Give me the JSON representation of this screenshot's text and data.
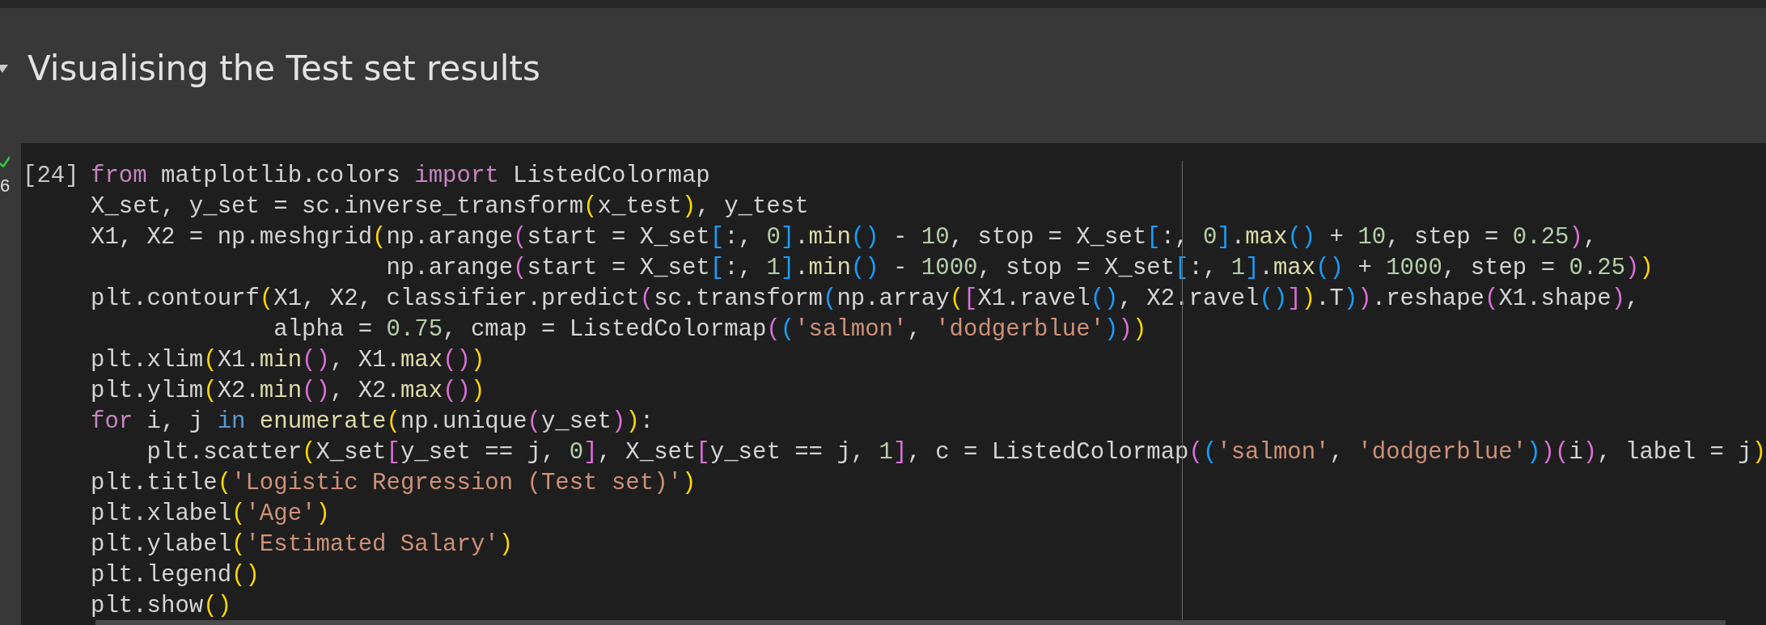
{
  "section": {
    "title": "Visualising the Test set results",
    "expanded": true
  },
  "cell": {
    "succeeded": true,
    "exec_time": "6",
    "prompt": "[24]",
    "lines": [
      {
        "tokens": [
          {
            "text": "from",
            "kind": "kw"
          },
          {
            "text": " matplotlib.colors ",
            "kind": "p"
          },
          {
            "text": "import",
            "kind": "kw"
          },
          {
            "text": " ListedColormap",
            "kind": "p"
          }
        ]
      },
      {
        "tokens": [
          {
            "text": "X_set, y_set = sc.inverse_transform",
            "kind": "p"
          },
          {
            "text": "(",
            "kind": "b1"
          },
          {
            "text": "x_test",
            "kind": "p"
          },
          {
            "text": ")",
            "kind": "b1"
          },
          {
            "text": ", y_test",
            "kind": "p"
          }
        ]
      },
      {
        "tokens": [
          {
            "text": "X1, X2 = np.meshgrid",
            "kind": "p"
          },
          {
            "text": "(",
            "kind": "b1"
          },
          {
            "text": "np.arange",
            "kind": "p"
          },
          {
            "text": "(",
            "kind": "b2"
          },
          {
            "text": "start = X_set",
            "kind": "p"
          },
          {
            "text": "[",
            "kind": "b3"
          },
          {
            "text": ":, ",
            "kind": "p"
          },
          {
            "text": "0",
            "kind": "n"
          },
          {
            "text": "]",
            "kind": "b3"
          },
          {
            "text": ".",
            "kind": "p"
          },
          {
            "text": "min",
            "kind": "f"
          },
          {
            "text": "()",
            "kind": "b3"
          },
          {
            "text": " - ",
            "kind": "p"
          },
          {
            "text": "10",
            "kind": "n"
          },
          {
            "text": ", stop = X_set",
            "kind": "p"
          },
          {
            "text": "[",
            "kind": "b3"
          },
          {
            "text": ":, ",
            "kind": "p"
          },
          {
            "text": "0",
            "kind": "n"
          },
          {
            "text": "]",
            "kind": "b3"
          },
          {
            "text": ".",
            "kind": "p"
          },
          {
            "text": "max",
            "kind": "f"
          },
          {
            "text": "()",
            "kind": "b3"
          },
          {
            "text": " + ",
            "kind": "p"
          },
          {
            "text": "10",
            "kind": "n"
          },
          {
            "text": ", step = ",
            "kind": "p"
          },
          {
            "text": "0.25",
            "kind": "n"
          },
          {
            "text": ")",
            "kind": "b2"
          },
          {
            "text": ",",
            "kind": "p"
          }
        ]
      },
      {
        "tokens": [
          {
            "text": "                     np.arange",
            "kind": "p"
          },
          {
            "text": "(",
            "kind": "b2"
          },
          {
            "text": "start = X_set",
            "kind": "p"
          },
          {
            "text": "[",
            "kind": "b3"
          },
          {
            "text": ":, ",
            "kind": "p"
          },
          {
            "text": "1",
            "kind": "n"
          },
          {
            "text": "]",
            "kind": "b3"
          },
          {
            "text": ".",
            "kind": "p"
          },
          {
            "text": "min",
            "kind": "f"
          },
          {
            "text": "()",
            "kind": "b3"
          },
          {
            "text": " - ",
            "kind": "p"
          },
          {
            "text": "1000",
            "kind": "n"
          },
          {
            "text": ", stop = X_set",
            "kind": "p"
          },
          {
            "text": "[",
            "kind": "b3"
          },
          {
            "text": ":, ",
            "kind": "p"
          },
          {
            "text": "1",
            "kind": "n"
          },
          {
            "text": "]",
            "kind": "b3"
          },
          {
            "text": ".",
            "kind": "p"
          },
          {
            "text": "max",
            "kind": "f"
          },
          {
            "text": "()",
            "kind": "b3"
          },
          {
            "text": " + ",
            "kind": "p"
          },
          {
            "text": "1000",
            "kind": "n"
          },
          {
            "text": ", step = ",
            "kind": "p"
          },
          {
            "text": "0.25",
            "kind": "n"
          },
          {
            "text": ")",
            "kind": "b2"
          },
          {
            "text": ")",
            "kind": "b1"
          }
        ]
      },
      {
        "tokens": [
          {
            "text": "plt.contourf",
            "kind": "p"
          },
          {
            "text": "(",
            "kind": "b1"
          },
          {
            "text": "X1, X2, classifier.predict",
            "kind": "p"
          },
          {
            "text": "(",
            "kind": "b2"
          },
          {
            "text": "sc.transform",
            "kind": "p"
          },
          {
            "text": "(",
            "kind": "b3"
          },
          {
            "text": "np.array",
            "kind": "p"
          },
          {
            "text": "(",
            "kind": "b1"
          },
          {
            "text": "[",
            "kind": "b2"
          },
          {
            "text": "X1.ravel",
            "kind": "p"
          },
          {
            "text": "()",
            "kind": "b3"
          },
          {
            "text": ", X2.ravel",
            "kind": "p"
          },
          {
            "text": "()",
            "kind": "b3"
          },
          {
            "text": "]",
            "kind": "b2"
          },
          {
            "text": ")",
            "kind": "b1"
          },
          {
            "text": ".T",
            "kind": "p"
          },
          {
            "text": ")",
            "kind": "b3"
          },
          {
            "text": ")",
            "kind": "b2"
          },
          {
            "text": ".reshape",
            "kind": "p"
          },
          {
            "text": "(",
            "kind": "b2"
          },
          {
            "text": "X1.shape",
            "kind": "p"
          },
          {
            "text": ")",
            "kind": "b2"
          },
          {
            "text": ",",
            "kind": "p"
          }
        ]
      },
      {
        "tokens": [
          {
            "text": "             alpha = ",
            "kind": "p"
          },
          {
            "text": "0.75",
            "kind": "n"
          },
          {
            "text": ", cmap = ListedColormap",
            "kind": "p"
          },
          {
            "text": "(",
            "kind": "b2"
          },
          {
            "text": "(",
            "kind": "b3"
          },
          {
            "text": "'salmon'",
            "kind": "s"
          },
          {
            "text": ", ",
            "kind": "p"
          },
          {
            "text": "'dodgerblue'",
            "kind": "s"
          },
          {
            "text": ")",
            "kind": "b3"
          },
          {
            "text": ")",
            "kind": "b2"
          },
          {
            "text": ")",
            "kind": "b1"
          }
        ]
      },
      {
        "tokens": [
          {
            "text": "plt.xlim",
            "kind": "p"
          },
          {
            "text": "(",
            "kind": "b1"
          },
          {
            "text": "X1.",
            "kind": "p"
          },
          {
            "text": "min",
            "kind": "f"
          },
          {
            "text": "()",
            "kind": "b2"
          },
          {
            "text": ", X1.",
            "kind": "p"
          },
          {
            "text": "max",
            "kind": "f"
          },
          {
            "text": "()",
            "kind": "b2"
          },
          {
            "text": ")",
            "kind": "b1"
          }
        ]
      },
      {
        "tokens": [
          {
            "text": "plt.ylim",
            "kind": "p"
          },
          {
            "text": "(",
            "kind": "b1"
          },
          {
            "text": "X2.",
            "kind": "p"
          },
          {
            "text": "min",
            "kind": "f"
          },
          {
            "text": "()",
            "kind": "b2"
          },
          {
            "text": ", X2.",
            "kind": "p"
          },
          {
            "text": "max",
            "kind": "f"
          },
          {
            "text": "()",
            "kind": "b2"
          },
          {
            "text": ")",
            "kind": "b1"
          }
        ]
      },
      {
        "tokens": [
          {
            "text": "for",
            "kind": "kw"
          },
          {
            "text": " i, j ",
            "kind": "p"
          },
          {
            "text": "in ",
            "kind": "kw2"
          },
          {
            "text": "enumerate",
            "kind": "f"
          },
          {
            "text": "(",
            "kind": "b1"
          },
          {
            "text": "np.unique",
            "kind": "p"
          },
          {
            "text": "(",
            "kind": "b2"
          },
          {
            "text": "y_set",
            "kind": "p"
          },
          {
            "text": ")",
            "kind": "b2"
          },
          {
            "text": ")",
            "kind": "b1"
          },
          {
            "text": ":",
            "kind": "p"
          }
        ]
      },
      {
        "tokens": [
          {
            "text": "    plt.scatter",
            "kind": "p"
          },
          {
            "text": "(",
            "kind": "b1"
          },
          {
            "text": "X_set",
            "kind": "p"
          },
          {
            "text": "[",
            "kind": "b2"
          },
          {
            "text": "y_set == j, ",
            "kind": "p"
          },
          {
            "text": "0",
            "kind": "n"
          },
          {
            "text": "]",
            "kind": "b2"
          },
          {
            "text": ", X_set",
            "kind": "p"
          },
          {
            "text": "[",
            "kind": "b2"
          },
          {
            "text": "y_set == j, ",
            "kind": "p"
          },
          {
            "text": "1",
            "kind": "n"
          },
          {
            "text": "]",
            "kind": "b2"
          },
          {
            "text": ", c = ListedColormap",
            "kind": "p"
          },
          {
            "text": "(",
            "kind": "b2"
          },
          {
            "text": "(",
            "kind": "b3"
          },
          {
            "text": "'salmon'",
            "kind": "s"
          },
          {
            "text": ", ",
            "kind": "p"
          },
          {
            "text": "'dodgerblue'",
            "kind": "s"
          },
          {
            "text": ")",
            "kind": "b3"
          },
          {
            "text": ")",
            "kind": "b2"
          },
          {
            "text": "(",
            "kind": "b2"
          },
          {
            "text": "i",
            "kind": "p"
          },
          {
            "text": ")",
            "kind": "b2"
          },
          {
            "text": ", label = j",
            "kind": "p"
          },
          {
            "text": ")",
            "kind": "b1"
          }
        ]
      },
      {
        "tokens": [
          {
            "text": "plt.title",
            "kind": "p"
          },
          {
            "text": "(",
            "kind": "b1"
          },
          {
            "text": "'Logistic Regression (Test set)'",
            "kind": "s"
          },
          {
            "text": ")",
            "kind": "b1"
          }
        ]
      },
      {
        "tokens": [
          {
            "text": "plt.xlabel",
            "kind": "p"
          },
          {
            "text": "(",
            "kind": "b1"
          },
          {
            "text": "'Age'",
            "kind": "s"
          },
          {
            "text": ")",
            "kind": "b1"
          }
        ]
      },
      {
        "tokens": [
          {
            "text": "plt.ylabel",
            "kind": "p"
          },
          {
            "text": "(",
            "kind": "b1"
          },
          {
            "text": "'Estimated Salary'",
            "kind": "s"
          },
          {
            "text": ")",
            "kind": "b1"
          }
        ]
      },
      {
        "tokens": [
          {
            "text": "plt.legend",
            "kind": "p"
          },
          {
            "text": "()",
            "kind": "b1"
          }
        ]
      },
      {
        "tokens": [
          {
            "text": "plt.show",
            "kind": "p"
          },
          {
            "text": "()",
            "kind": "b1"
          }
        ]
      }
    ]
  }
}
